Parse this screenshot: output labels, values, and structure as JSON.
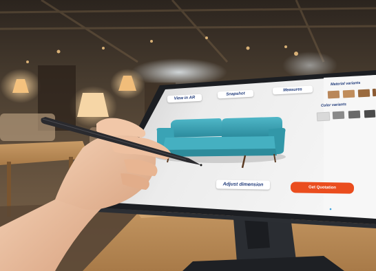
{
  "screen": {
    "top_buttons": [
      {
        "label": "View in AR"
      },
      {
        "label": "Snapshot"
      },
      {
        "label": "Measures"
      }
    ],
    "adjust_label": "Adjust dimension",
    "quote_label": "Get Quotation",
    "material_title": "Material variants",
    "color_title": "Color variants",
    "material_swatches": [
      "#b9875a",
      "#c08d5c",
      "#9a6a3e",
      "#8b5a32"
    ],
    "color_swatches": [
      "#d9d9d9",
      "#8a8a8a",
      "#6a6a6a",
      "#4a4a4a"
    ],
    "sofa_color": "#3aa3b5",
    "accent_color": "#ea4d1e"
  }
}
